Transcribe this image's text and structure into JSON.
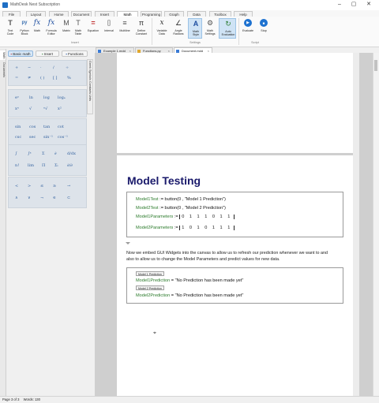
{
  "window": {
    "title": "MathDesk Nest Subscription"
  },
  "ribbon_tabs": [
    "File",
    "Layout",
    "Home",
    "Document",
    "Insert",
    "Math",
    "Programing",
    "Graph",
    "Data",
    "Toolbox",
    "Help"
  ],
  "ribbon": {
    "buttons": [
      {
        "label": "Text\nCode",
        "icon": "T"
      },
      {
        "label": "Python\nBlock",
        "icon": "py"
      },
      {
        "label": "Math",
        "icon": "fx"
      },
      {
        "label": "Formula\nEditor",
        "icon": "fx"
      },
      {
        "label": "Matrix",
        "icon": "M"
      },
      {
        "label": "Math\nTable",
        "icon": "T"
      },
      {
        "label": "Equation",
        "icon": "="
      },
      {
        "label": "Interval",
        "icon": "[]"
      },
      {
        "label": "Multiline",
        "icon": "≡"
      },
      {
        "label": "Define\nConstant",
        "icon": "π"
      },
      {
        "label": "Variable\nData",
        "icon": "x"
      },
      {
        "label": "Angle\nRadians",
        "icon": "∠"
      },
      {
        "label": "Math\nStyle",
        "icon": "A"
      },
      {
        "label": "Math\nSettings",
        "icon": "⚙"
      },
      {
        "label": "Auto\nEvaluation",
        "icon": "↻"
      },
      {
        "label": "Evaluate",
        "icon": "▶"
      },
      {
        "label": "Stop",
        "icon": "■"
      }
    ],
    "groups": [
      "Insert",
      "Settings",
      "Script"
    ]
  },
  "left_vtabs": [
    "Math",
    "Documents"
  ],
  "panel_tabs": [
    "Basic math",
    "Insert",
    "Functions"
  ],
  "side_strip": [
    "Greek",
    "Symbols",
    "Constants",
    "Units"
  ],
  "symbols": {
    "row1": [
      "+",
      "−",
      "·",
      "/",
      "÷"
    ],
    "row2": [
      "=",
      "≠",
      "( )",
      "[ ]",
      "%"
    ],
    "row3": [
      "eˣ",
      "ln",
      "log",
      "logₐ"
    ],
    "row4": [
      "xⁿ",
      "√",
      "ⁿ√",
      "x²"
    ],
    "row5": [
      "sin",
      "cos",
      "tan",
      "cot"
    ],
    "row6": [
      "csc",
      "sec",
      "sin⁻¹",
      "cos⁻¹"
    ],
    "row7": [
      "∫",
      "∫ᵃ",
      "Σ",
      "∂",
      "d/dx"
    ],
    "row8": [
      "n!",
      "lim",
      "Π",
      "Σᵢ",
      "∂/∂"
    ],
    "row9": [
      "<",
      ">",
      "≤",
      "≥",
      "→"
    ],
    "row10": [
      "∧",
      "∨",
      "¬",
      "∈",
      "⊂"
    ]
  },
  "doc_tabs": [
    {
      "label": "Example 1.mdd",
      "active": false
    },
    {
      "label": "Functions.py",
      "active": false
    },
    {
      "label": "Document.mdd",
      "active": true
    }
  ],
  "document": {
    "heading": "Model Testing",
    "block1": [
      {
        "var": "Model1Test",
        "op": ":= button",
        "args": "(0 , \"Model 1 Prediction\")"
      },
      {
        "var": "Model2Test",
        "op": ":= button",
        "args": "(0 , \"Model 2 Prediction\")"
      },
      {
        "var": "Model1Parameters",
        "op": ":=",
        "matrix": "0 1 1 1 0 1 1"
      },
      {
        "var": "Model2Parameters",
        "op": ":=",
        "matrix": "1 0 1 0 1 1 1"
      }
    ],
    "paragraph_line1": "Now we embed GUI Widgets into the canvas to allow us to refresh our prediction whenever we want to and",
    "paragraph_line2": "also to allow us to change the Model Parameters and predict values for new data.",
    "widget1_label": "Model 1 Prediction",
    "prediction1_var": "Model1Prediction",
    "prediction1_value": "= \"No Prediction has been made yet\"",
    "widget2_label": "Model 2 Prediction",
    "prediction2_var": "Model2Prediction",
    "prediction2_value": "= \"No Prediction has been made yet\""
  },
  "status": {
    "page": "Page 3 of 3",
    "words": "Words: 130"
  }
}
